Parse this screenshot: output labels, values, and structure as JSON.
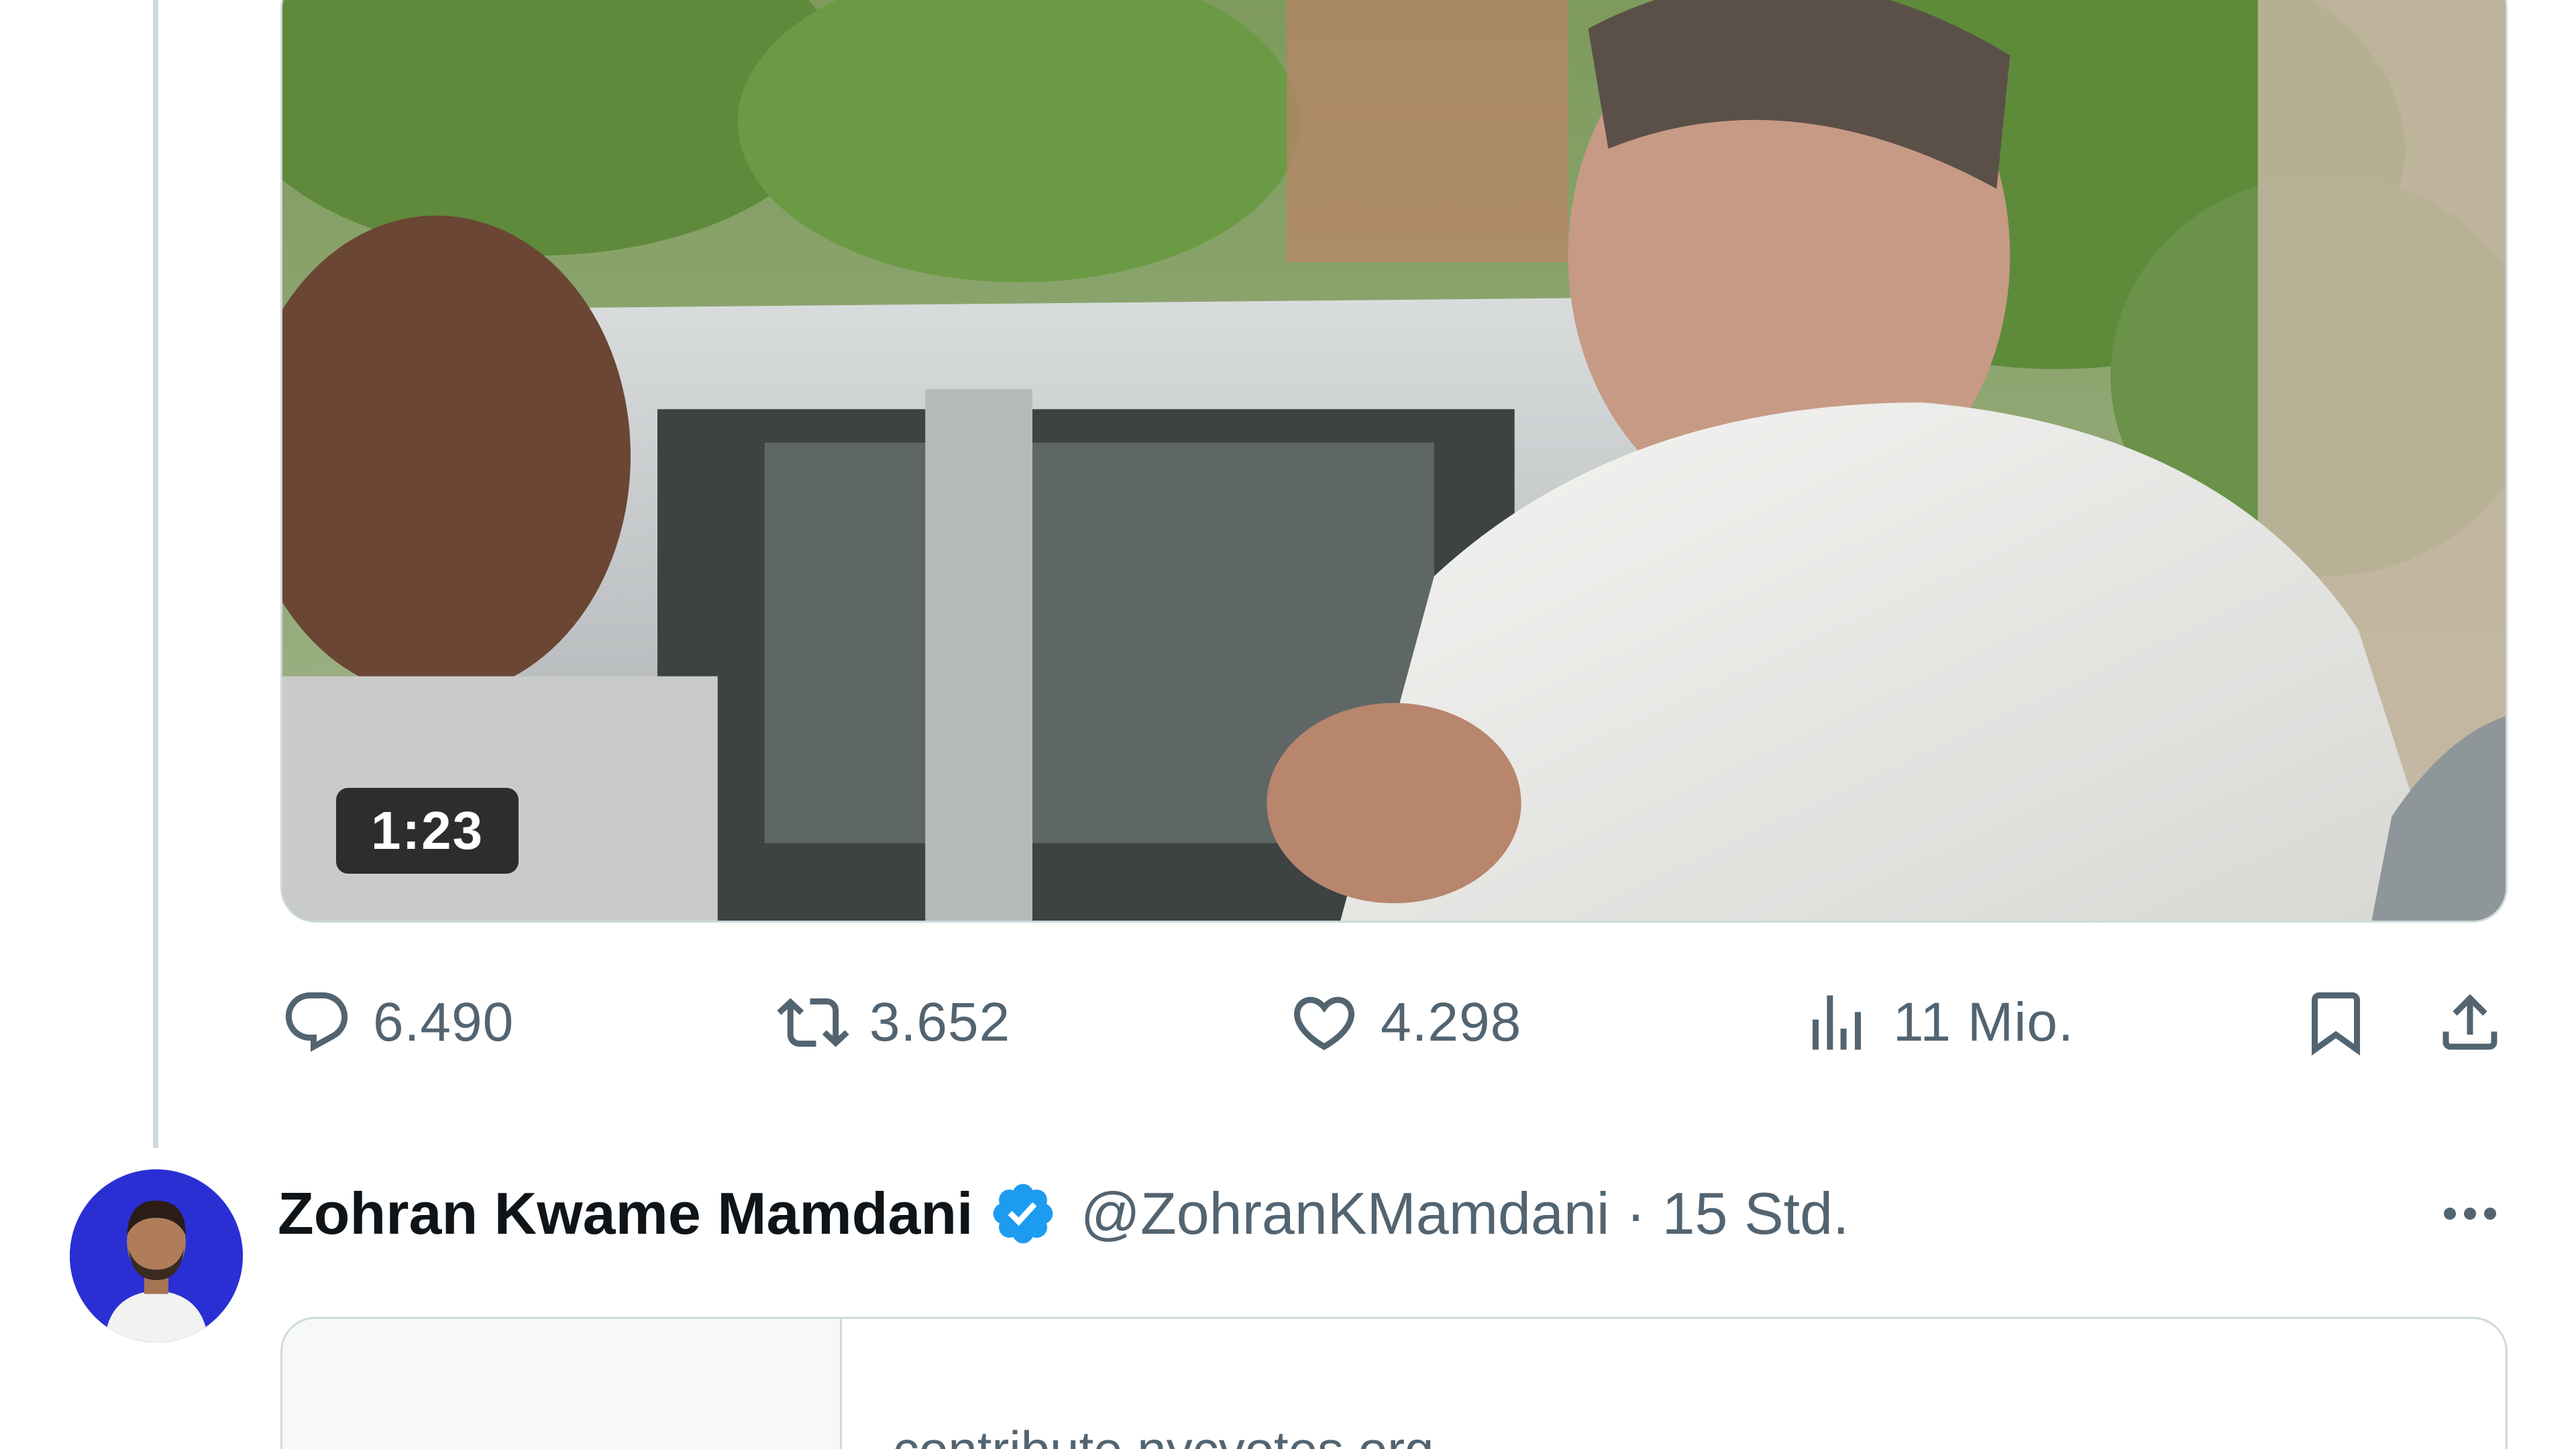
{
  "media": {
    "duration": "1:23"
  },
  "actions": {
    "replies": "6.490",
    "reposts": "3.652",
    "likes": "4.298",
    "views": "11 Mio."
  },
  "reply_tweet": {
    "display_name": "Zohran Kwame Mamdani",
    "verified": true,
    "handle_time": "@ZohranKMamdani · 15 Std.",
    "card": {
      "domain": "contribute.nycvotes.org"
    }
  },
  "colors": {
    "text_primary": "#0f1419",
    "text_secondary": "#536471",
    "border": "#cfd9de",
    "verified_blue": "#1d9bf0",
    "avatar_bg": "#2a2fd4"
  },
  "icons": [
    "reply-icon",
    "repost-icon",
    "like-icon",
    "views-icon",
    "bookmark-icon",
    "share-icon",
    "verified-badge-icon",
    "more-options-icon"
  ]
}
